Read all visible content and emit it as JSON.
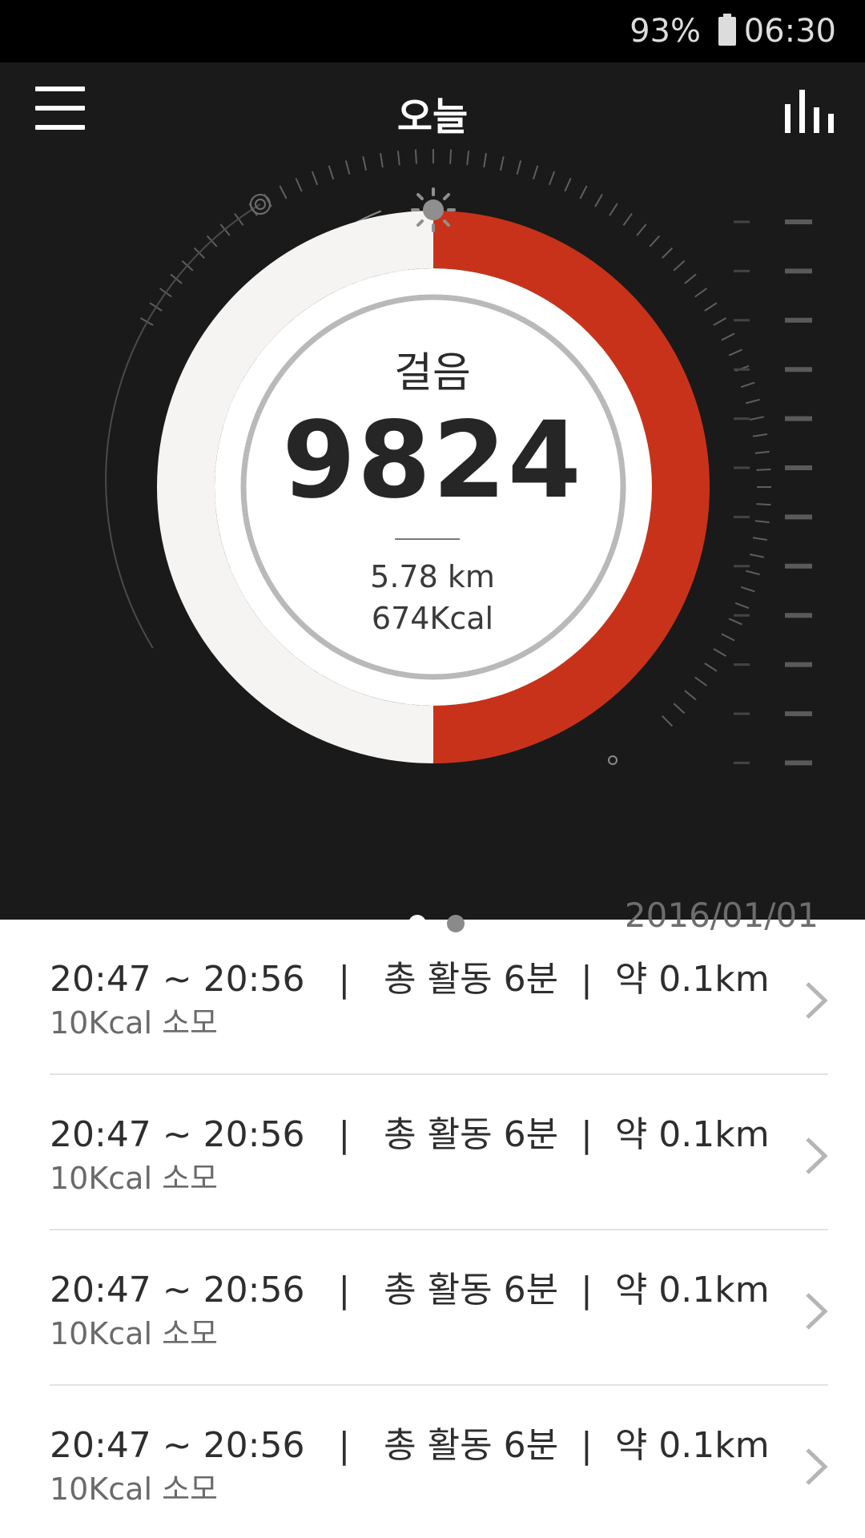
{
  "status_bar": {
    "battery": "93%",
    "time": "06:30"
  },
  "header": {
    "title": "오늘"
  },
  "gauge": {
    "label": "걸음",
    "steps": "9824",
    "distance": "5.78 km",
    "calories": "674Kcal",
    "progress_fraction": 0.5,
    "accent_color": "#c9321a"
  },
  "pager": {
    "pages": 2,
    "active": 0
  },
  "date": "2016/01/01",
  "activities": [
    {
      "summary": "20:47 ~ 20:56   |   총 활동 6분  |  약 0.1km",
      "calories": "10Kcal 소모"
    },
    {
      "summary": "20:47 ~ 20:56   |   총 활동 6분  |  약 0.1km",
      "calories": "10Kcal 소모"
    },
    {
      "summary": "20:47 ~ 20:56   |   총 활동 6분  |  약 0.1km",
      "calories": "10Kcal 소모"
    },
    {
      "summary": "20:47 ~ 20:56   |   총 활동 6분  |  약 0.1km",
      "calories": "10Kcal 소모"
    }
  ],
  "icons": {
    "battery": "battery-icon",
    "menu": "hamburger-menu-icon",
    "stats": "bar-chart-icon",
    "sun": "sun-icon",
    "target": "target-icon",
    "chevron": "chevron-right-icon"
  }
}
